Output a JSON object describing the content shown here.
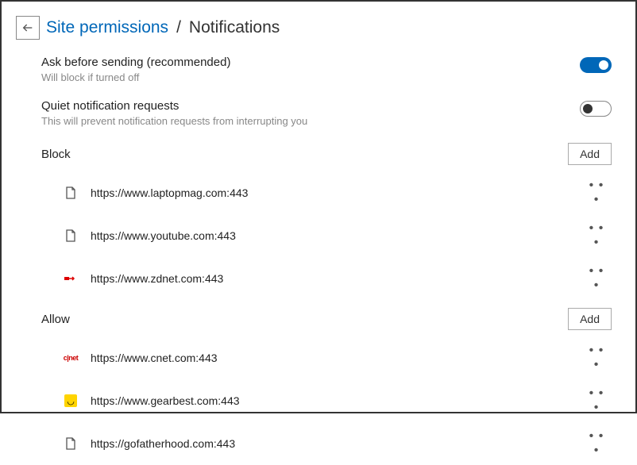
{
  "breadcrumb": {
    "parent": "Site permissions",
    "separator": "/",
    "current": "Notifications"
  },
  "settings": {
    "ask": {
      "title": "Ask before sending (recommended)",
      "desc": "Will block if turned off",
      "on": true
    },
    "quiet": {
      "title": "Quiet notification requests",
      "desc": "This will prevent notification requests from interrupting you",
      "on": false
    }
  },
  "sections": {
    "block": {
      "title": "Block",
      "add_label": "Add",
      "sites": [
        {
          "url": "https://www.laptopmag.com:443",
          "icon": "file"
        },
        {
          "url": "https://www.youtube.com:443",
          "icon": "file"
        },
        {
          "url": "https://www.zdnet.com:443",
          "icon": "zdnet"
        }
      ]
    },
    "allow": {
      "title": "Allow",
      "add_label": "Add",
      "sites": [
        {
          "url": "https://www.cnet.com:443",
          "icon": "cnet"
        },
        {
          "url": "https://www.gearbest.com:443",
          "icon": "gearbest"
        },
        {
          "url": "https://gofatherhood.com:443",
          "icon": "file"
        }
      ]
    }
  },
  "more_glyph": "• • •"
}
